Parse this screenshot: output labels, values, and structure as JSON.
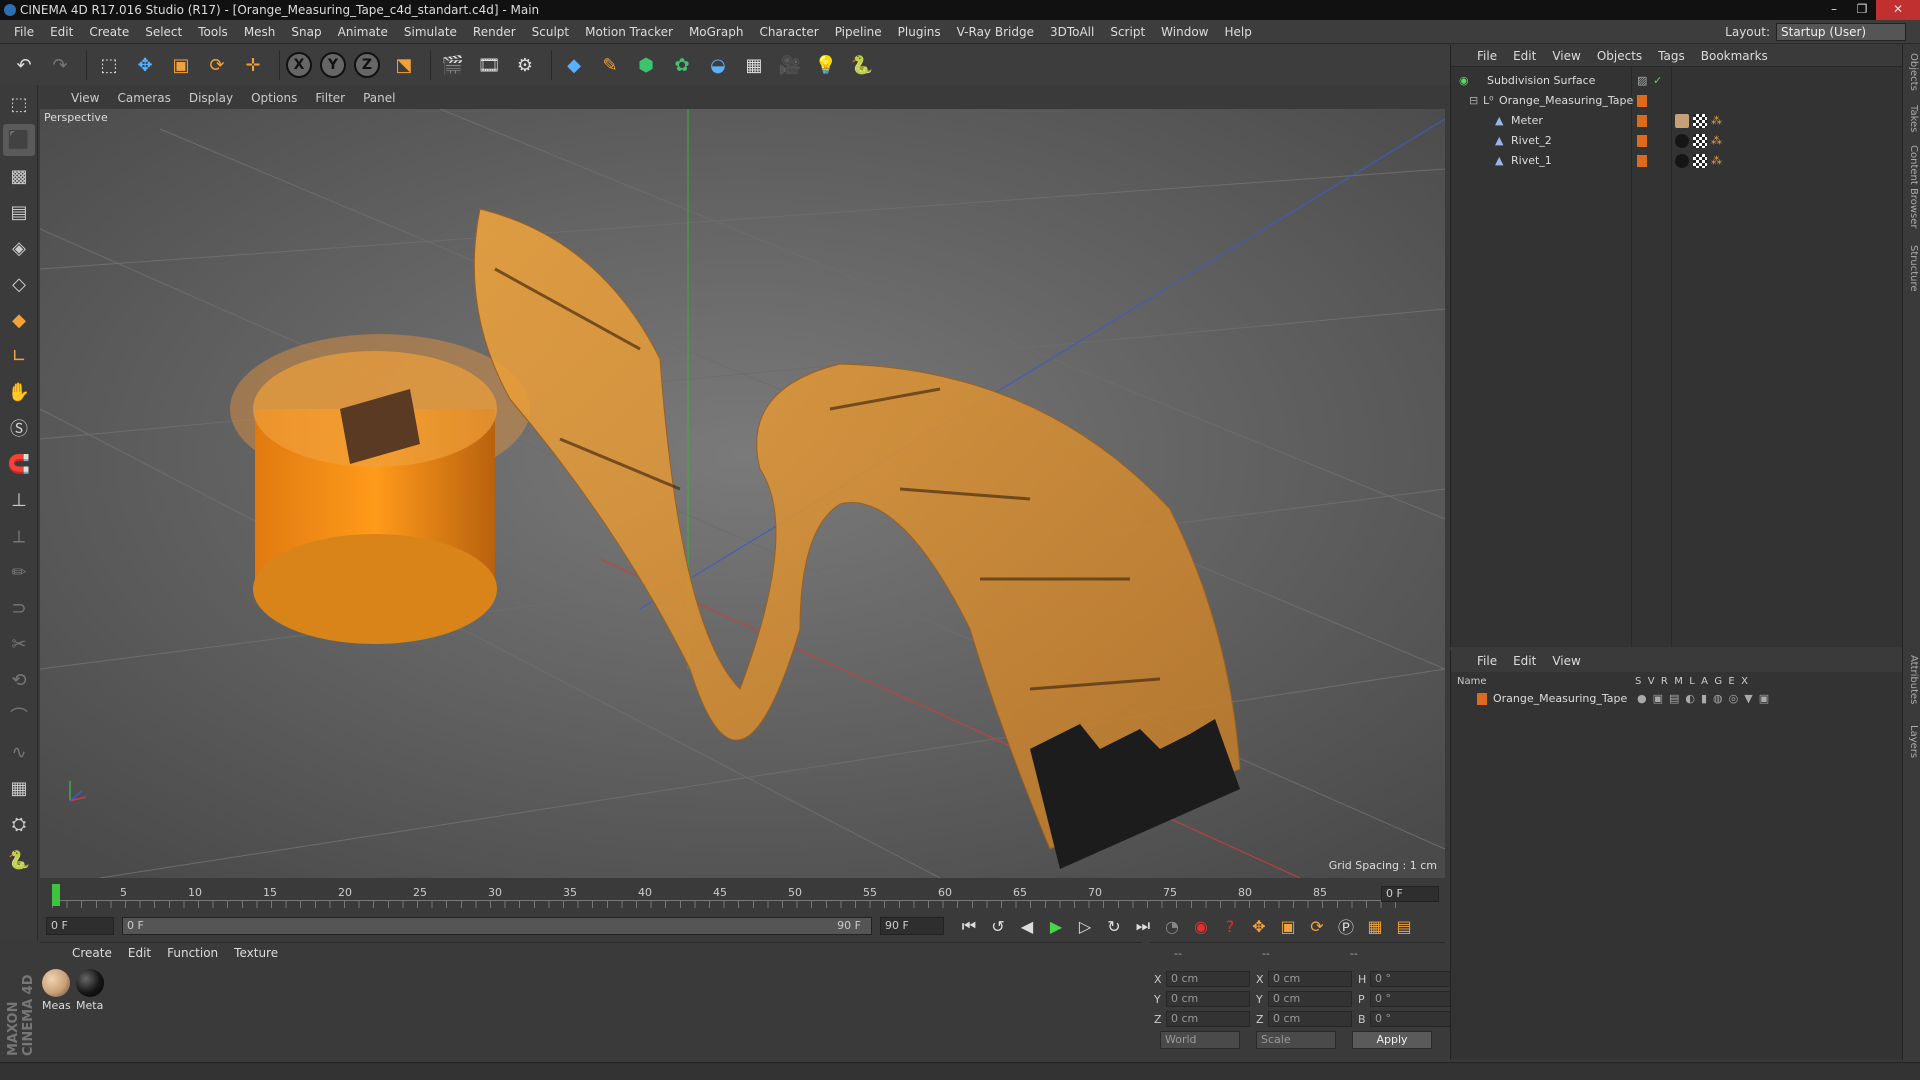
{
  "window": {
    "title": "CINEMA 4D R17.016 Studio (R17) - [Orange_Measuring_Tape_c4d_standart.c4d] - Main"
  },
  "menubar": [
    "File",
    "Edit",
    "Create",
    "Select",
    "Tools",
    "Mesh",
    "Snap",
    "Animate",
    "Simulate",
    "Render",
    "Sculpt",
    "Motion Tracker",
    "MoGraph",
    "Character",
    "Pipeline",
    "Plugins",
    "V-Ray Bridge",
    "3DToAll",
    "Script",
    "Window",
    "Help"
  ],
  "layout": {
    "label": "Layout:",
    "value": "Startup (User)"
  },
  "viewport": {
    "menu": [
      "View",
      "Cameras",
      "Display",
      "Options",
      "Filter",
      "Panel"
    ],
    "label": "Perspective",
    "grid_spacing": "Grid Spacing : 1 cm"
  },
  "timeline": {
    "ticks": [
      "0",
      "5",
      "10",
      "15",
      "20",
      "25",
      "30",
      "35",
      "40",
      "45",
      "50",
      "55",
      "60",
      "65",
      "70",
      "75",
      "80",
      "85",
      "90"
    ],
    "current_frame": "0 F"
  },
  "transport": {
    "start_field": "0 F",
    "range_start": "0 F",
    "range_end": "90 F",
    "end_field": "90 F"
  },
  "materials": {
    "menu": [
      "Create",
      "Edit",
      "Function",
      "Texture"
    ],
    "items": [
      {
        "label": "Meas",
        "color": "#c8a078"
      },
      {
        "label": "Meta",
        "color": "#151515"
      }
    ]
  },
  "coordinates": {
    "headers": [
      "--",
      "--",
      "--"
    ],
    "rows": [
      {
        "a1": "X",
        "v1": "0 cm",
        "a2": "X",
        "v2": "0 cm",
        "a3": "H",
        "v3": "0 °"
      },
      {
        "a1": "Y",
        "v1": "0 cm",
        "a2": "Y",
        "v2": "0 cm",
        "a3": "P",
        "v3": "0 °"
      },
      {
        "a1": "Z",
        "v1": "0 cm",
        "a2": "Z",
        "v2": "0 cm",
        "a3": "B",
        "v3": "0 °"
      }
    ],
    "mode": "World",
    "transform": "Scale",
    "apply": "Apply"
  },
  "objects": {
    "menu": [
      "File",
      "Edit",
      "View",
      "Objects",
      "Tags",
      "Bookmarks"
    ],
    "tree": [
      {
        "name": "Subdivision Surface"
      },
      {
        "name": "Orange_Measuring_Tape"
      },
      {
        "name": "Meter"
      },
      {
        "name": "Rivet_2"
      },
      {
        "name": "Rivet_1"
      }
    ]
  },
  "layers": {
    "menu": [
      "File",
      "Edit",
      "View"
    ],
    "columns": {
      "name": "Name",
      "flags": "S  V  R  M  L  A  G  E  X"
    },
    "items": [
      {
        "name": "Orange_Measuring_Tape",
        "color": "#e06a1c"
      }
    ]
  },
  "sidetabs": [
    "Objects",
    "Takes",
    "Content Browser",
    "Structure",
    "Attributes",
    "Layers"
  ],
  "brand": "MAXON CINEMA 4D",
  "colors": {
    "accent": "#e06a1c",
    "tape": "#f2a23a",
    "play": "#4cd24c"
  }
}
